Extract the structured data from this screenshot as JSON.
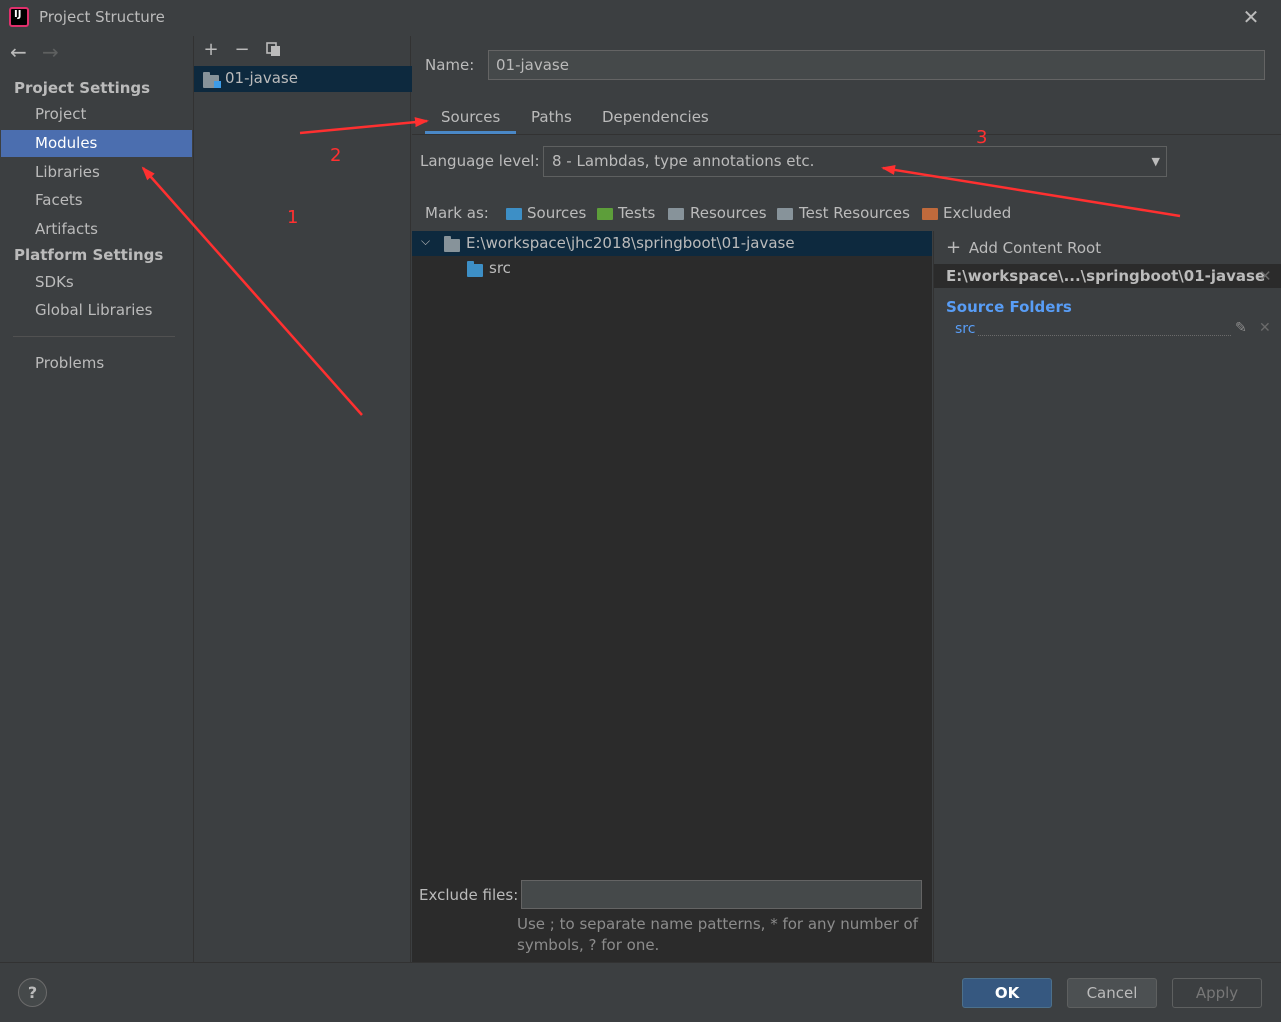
{
  "window": {
    "title": "Project Structure"
  },
  "sidebar": {
    "project_settings_header": "Project Settings",
    "project_items": [
      {
        "label": "Project"
      },
      {
        "label": "Modules"
      },
      {
        "label": "Libraries"
      },
      {
        "label": "Facets"
      },
      {
        "label": "Artifacts"
      }
    ],
    "platform_settings_header": "Platform Settings",
    "platform_items": [
      {
        "label": "SDKs"
      },
      {
        "label": "Global Libraries"
      }
    ],
    "problems_label": "Problems",
    "selected": "Modules"
  },
  "module_list": {
    "items": [
      {
        "label": "01-javase"
      }
    ]
  },
  "module": {
    "name_label": "Name:",
    "name_value": "01-javase",
    "tabs": [
      {
        "label": "Sources"
      },
      {
        "label": "Paths"
      },
      {
        "label": "Dependencies"
      }
    ],
    "active_tab": "Sources",
    "language_level_label": "Language level:",
    "language_level_value": "8 - Lambdas, type annotations etc.",
    "mark_as_label": "Mark as:",
    "mark_as": [
      {
        "label": "Sources",
        "color": "#3d8fc6"
      },
      {
        "label": "Tests",
        "color": "#5d9e3a"
      },
      {
        "label": "Resources",
        "color": "#87939a"
      },
      {
        "label": "Test Resources",
        "color": "#87939a"
      },
      {
        "label": "Excluded",
        "color": "#c06a3c"
      }
    ],
    "tree": {
      "root": "E:\\workspace\\jhc2018\\springboot\\01-javase",
      "children": [
        {
          "label": "src"
        }
      ]
    },
    "content_root": {
      "add_label": "Add Content Root",
      "path": "E:\\workspace\\...\\springboot\\01-javase",
      "source_folders_header": "Source Folders",
      "source_folders": [
        {
          "label": "src"
        }
      ]
    },
    "exclude_files_label": "Exclude files:",
    "exclude_files_value": "",
    "exclude_hint_line1": "Use ; to separate name patterns, * for any number of",
    "exclude_hint_line2": "symbols, ? for one."
  },
  "buttons": {
    "ok": "OK",
    "cancel": "Cancel",
    "apply": "Apply",
    "help": "?"
  },
  "annotations": [
    {
      "label": "1"
    },
    {
      "label": "2"
    },
    {
      "label": "3"
    }
  ],
  "colors": {
    "accent": "#4b6eaf",
    "annotation": "#ff3030",
    "selected_row": "#0d293e",
    "source_folder": "#589df6"
  }
}
